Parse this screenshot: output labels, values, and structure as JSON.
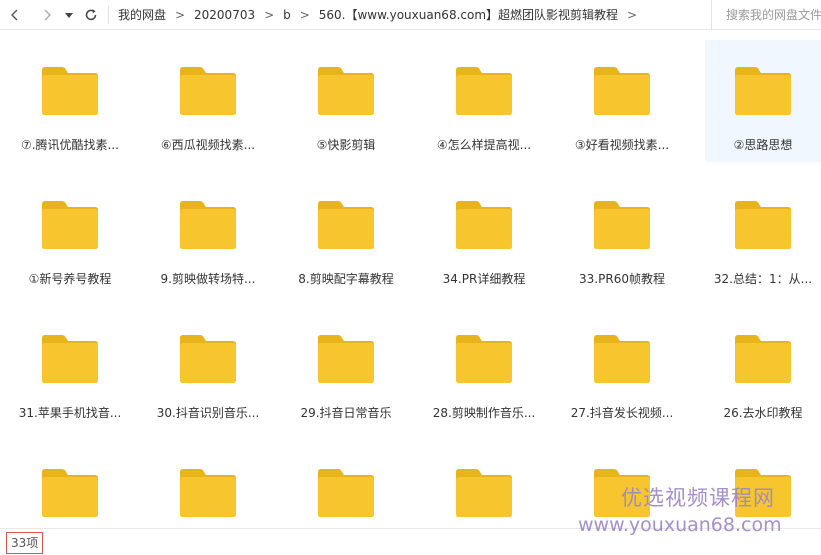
{
  "toolbar": {
    "icons": [
      "chevron-left-icon",
      "chevron-right-icon",
      "dropdown-icon",
      "refresh-icon"
    ],
    "breadcrumb": [
      {
        "label": "我的网盘"
      },
      {
        "label": "20200703"
      },
      {
        "label": "b"
      },
      {
        "label": "560.【www.youxuan68.com】超燃团队影视剪辑教程"
      }
    ],
    "separator": ">",
    "search_placeholder": "搜索我的网盘文件"
  },
  "folders": [
    {
      "label": "⑦.腾讯优酷找素..."
    },
    {
      "label": "⑥西瓜视频找素..."
    },
    {
      "label": "⑤快影剪辑"
    },
    {
      "label": "④怎么样提高视..."
    },
    {
      "label": "③好看视频找素..."
    },
    {
      "label": "②思路思想",
      "selected": true
    },
    {
      "label": "①新号养号教程"
    },
    {
      "label": "9.剪映做转场特..."
    },
    {
      "label": "8.剪映配字幕教程"
    },
    {
      "label": "34.PR详细教程"
    },
    {
      "label": "33.PR60帧教程"
    },
    {
      "label": "32.总结：1：从..."
    },
    {
      "label": "31.苹果手机找音..."
    },
    {
      "label": "30.抖音识别音乐..."
    },
    {
      "label": "29.抖音日常音乐"
    },
    {
      "label": "28.剪映制作音乐..."
    },
    {
      "label": "27.抖音发长视频..."
    },
    {
      "label": "26.去水印教程"
    },
    {
      "label": ""
    },
    {
      "label": ""
    },
    {
      "label": ""
    },
    {
      "label": ""
    },
    {
      "label": ""
    },
    {
      "label": ""
    }
  ],
  "colors": {
    "folder_back": "#e8b41c",
    "folder_front": "#f7c62f",
    "selected_bg": "#f1f7fe",
    "badge_border": "#d9534f",
    "watermark": "#9e86c6"
  },
  "status": {
    "count": "33项"
  },
  "watermark": {
    "line1": "优选视频课程网",
    "line2": "www.youxuan68.com"
  }
}
